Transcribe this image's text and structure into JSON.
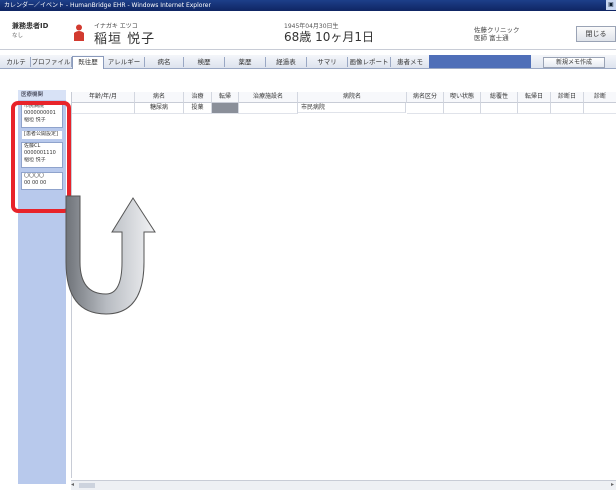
{
  "window": {
    "title": "カレンダー／イベント - HumanBridge EHR - Windows Internet Explorer"
  },
  "header": {
    "label": "兼務患者ID",
    "sub_label": "なし",
    "name_kana": "イナガキ エツコ",
    "name": "稲垣 悦子",
    "birth": "1945年04月30日生",
    "age": "68歳 10ヶ月1日",
    "clinic_name": "佐藤クリニック",
    "clinic_doctor": "医師 富士通",
    "close_label": "閉じる"
  },
  "tabs": [
    {
      "label": "カルテ"
    },
    {
      "label": "プロファイル"
    },
    {
      "label": "既往歴"
    },
    {
      "label": "アレルギー"
    },
    {
      "label": "病名"
    },
    {
      "label": "検歴"
    },
    {
      "label": "薬歴"
    },
    {
      "label": "経過表"
    },
    {
      "label": "サマリ"
    },
    {
      "label": "画像レポート"
    },
    {
      "label": "患者メモ"
    }
  ],
  "active_tab": "既往歴",
  "new_memo_label": "新規メモ作成",
  "left_panel": {
    "header": "医療機関",
    "card1": [
      "市民病院",
      "0000000001",
      "稲垣 悦子"
    ],
    "card2_label": "[患者公開設定]",
    "card3": [
      "佐藤CL",
      "0000001110",
      "稲垣 悦子"
    ],
    "card4": [
      "〇〇〇〇",
      "00 00 00"
    ]
  },
  "grid": {
    "columns": [
      "年齢/年/月",
      "病名",
      "治療",
      "転帰",
      "治療施設名",
      "病院名",
      "病名区分",
      "喫い状態",
      "総覆性",
      "転帰日",
      "診断日",
      "診断"
    ],
    "rows": [
      [
        "",
        "糖尿病",
        "投薬",
        "",
        "",
        "市民病院",
        "",
        "",
        "",
        "",
        "",
        ""
      ]
    ]
  },
  "colors": {
    "highlight": "#e8232a",
    "title_bar": "#0f2563",
    "tab_accent": "#4f6fb8",
    "side_panel": "#b8c9ec"
  }
}
